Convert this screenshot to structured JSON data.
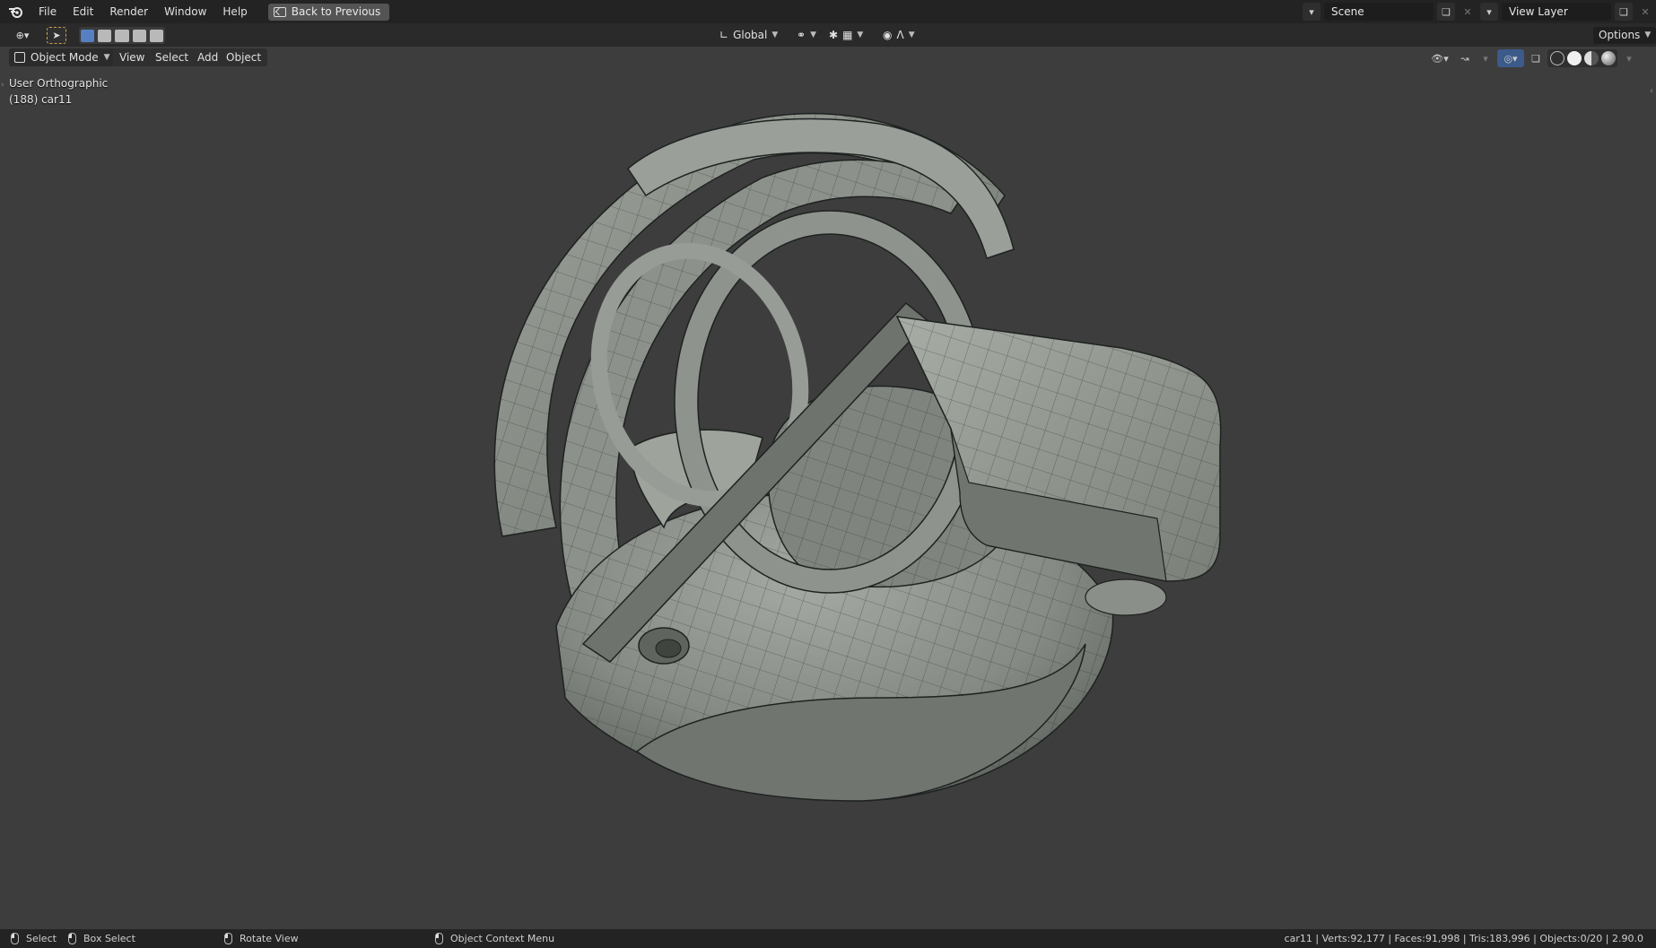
{
  "menu": {
    "items": [
      "File",
      "Edit",
      "Render",
      "Window",
      "Help"
    ],
    "back_label": "Back to Previous"
  },
  "scene": {
    "label": "Scene",
    "view_layer": "View Layer"
  },
  "toolheader": {
    "transform_orientation": "Global",
    "options_label": "Options"
  },
  "viewport_header": {
    "mode": "Object Mode",
    "menus": [
      "View",
      "Select",
      "Add",
      "Object"
    ]
  },
  "viewport": {
    "view_name": "User Orthographic",
    "object_info": "(188) car11"
  },
  "statusbar": {
    "select": "Select",
    "box_select": "Box Select",
    "rotate": "Rotate View",
    "context_menu": "Object Context Menu",
    "stats": "car11 | Verts:92,177 | Faces:91,998 | Tris:183,996 | Objects:0/20 | 2.90.0"
  },
  "colors": {
    "bg": "#3d3d3d",
    "menubar": "#232323",
    "accent_blue": "#5680c2",
    "mesh": "#8f948f",
    "wire": "#1e2220"
  },
  "icons": [
    "blender-logo-icon",
    "editor-type-icon",
    "select-tool-icon",
    "global-orientation-icon",
    "snap-icon",
    "proportional-edit-icon",
    "overlay-icon",
    "shading-solid-icon"
  ]
}
